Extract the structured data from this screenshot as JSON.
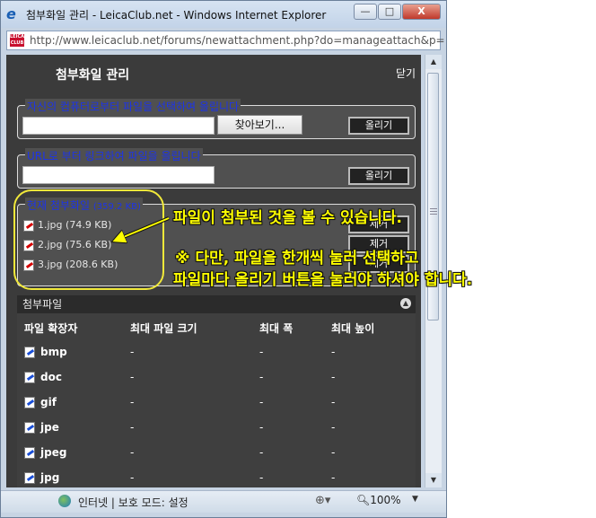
{
  "window": {
    "title": "첨부화일 관리 - LeicaClub.net - Windows Internet Explorer",
    "minimize_glyph": "—",
    "restore_glyph": "□",
    "close_glyph": "X"
  },
  "address": {
    "url": "http://www.leicaclub.net/forums/newattachment.php?do=manageattach&p=",
    "site_icon_text": "LEICA CLUB"
  },
  "header": {
    "title": "첨부화일 관리",
    "close_label": "닫기"
  },
  "upload_computer": {
    "legend": "자신의 컴퓨터로부터 파일을 선택하여 올립니다",
    "browse_label": "찾아보기...",
    "upload_label": "올리기",
    "value": ""
  },
  "upload_url": {
    "legend": "URL로 부터 링크하여 파일을 올립니다",
    "upload_label": "올리기",
    "value": ""
  },
  "current": {
    "legend": "현재 첨부화일",
    "total": "(359.2 KB)",
    "files": [
      {
        "name": "1.jpg",
        "size": "(74.9 KB)",
        "remove_label": "제거"
      },
      {
        "name": "2.jpg",
        "size": "(75.6 KB)",
        "remove_label": "제거"
      },
      {
        "name": "3.jpg",
        "size": "(208.6 KB)",
        "remove_label": "제거"
      }
    ]
  },
  "attach_types": {
    "title": "첨부파일",
    "columns": [
      "파일 확장자",
      "최대 파일 크기",
      "최대 폭",
      "최대 높이"
    ],
    "rows": [
      {
        "ext": "bmp",
        "size": "-",
        "width": "-",
        "height": "-"
      },
      {
        "ext": "doc",
        "size": "-",
        "width": "-",
        "height": "-"
      },
      {
        "ext": "gif",
        "size": "-",
        "width": "-",
        "height": "-"
      },
      {
        "ext": "jpe",
        "size": "-",
        "width": "-",
        "height": "-"
      },
      {
        "ext": "jpeg",
        "size": "-",
        "width": "-",
        "height": "-"
      },
      {
        "ext": "jpg",
        "size": "-",
        "width": "-",
        "height": "-"
      }
    ]
  },
  "status": {
    "zone": "인터넷 | 보호 모드: 설정",
    "zoom": "100%"
  },
  "annotation": {
    "line1": "파일이 첨부된 것을  볼 수 있습니다.",
    "line2": "※ 다만, 파일을 한개씩 눌러 선택하고",
    "line3": "파일마다 올리기 버튼을 눌러야 하셔야 합니다."
  },
  "colors": {
    "annotation": "#ffff00",
    "legend_text": "#1d34e8",
    "panel_bg": "#3b3b3b"
  }
}
